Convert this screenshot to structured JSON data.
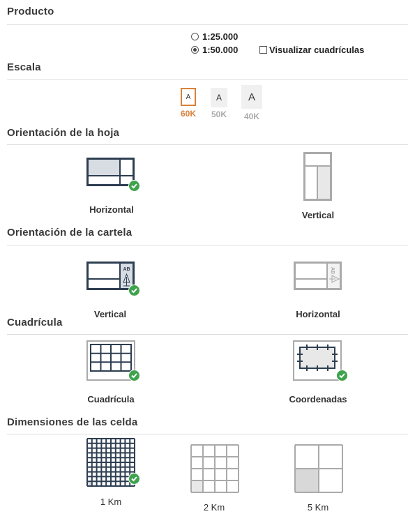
{
  "sections": {
    "producto": "Producto",
    "escala": "Escala",
    "orientacion_hoja": "Orientación de la hoja",
    "orientacion_cartela": "Orientación de la cartela",
    "cuadricula": "Cuadrícula",
    "dimensiones": "Dimensiones de las celda"
  },
  "producto": {
    "scale_options": [
      {
        "label": "1:25.000",
        "selected": false
      },
      {
        "label": "1:50.000",
        "selected": true
      }
    ],
    "show_grid": {
      "label": "Visualizar cuadrículas",
      "checked": false
    }
  },
  "escala": {
    "options": [
      {
        "glyph": "A",
        "caption": "60K",
        "selected": true,
        "color": "#d9823b"
      },
      {
        "glyph": "A",
        "caption": "50K",
        "selected": false,
        "color": "#aaaaaa"
      },
      {
        "glyph": "A",
        "caption": "40K",
        "selected": false,
        "color": "#aaaaaa"
      }
    ]
  },
  "orientacion_hoja": {
    "options": [
      {
        "label": "Horizontal",
        "selected": true
      },
      {
        "label": "Vertical",
        "selected": false
      }
    ]
  },
  "orientacion_cartela": {
    "options": [
      {
        "label": "Vertical",
        "selected": true,
        "badge": "AB"
      },
      {
        "label": "Horizontal",
        "selected": false,
        "badge": "AB"
      }
    ]
  },
  "cuadricula": {
    "options": [
      {
        "label": "Cuadrícula",
        "selected": true
      },
      {
        "label": "Coordenadas",
        "selected": true
      }
    ]
  },
  "dimensiones": {
    "options": [
      {
        "label": "1 Km",
        "selected": true
      },
      {
        "label": "2 Km",
        "selected": false
      },
      {
        "label": "5 Km",
        "selected": false
      }
    ]
  },
  "colors": {
    "accent": "#d9823b",
    "selected_stroke": "#2e3e52",
    "unselected_stroke": "#aaaaaa",
    "check_green": "#3fa34d"
  }
}
